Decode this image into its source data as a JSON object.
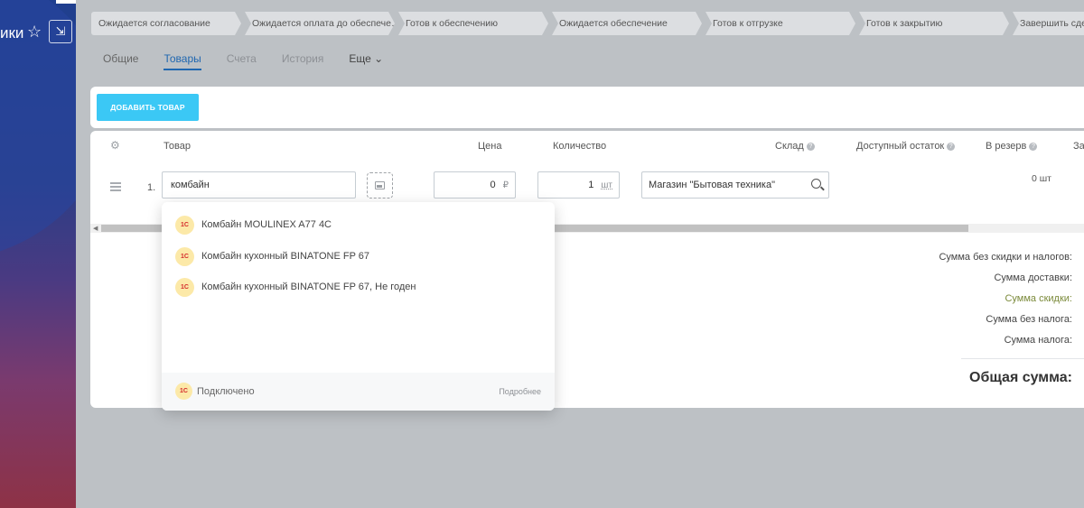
{
  "sidebar": {
    "title_fragment": "ики",
    "star_icon": "star-icon",
    "pin_icon": "collapse-arrow-icon"
  },
  "stages": [
    "Ожидается согласование",
    "Ожидается оплата до обеспече…",
    "Готов к обеспечению",
    "Ожидается обеспечение",
    "Готов к отгрузке",
    "Готов к закрытию",
    "Завершить сдел"
  ],
  "tabs": [
    {
      "label": "Общие",
      "state": "normal"
    },
    {
      "label": "Товары",
      "state": "active"
    },
    {
      "label": "Счета",
      "state": "muted"
    },
    {
      "label": "История",
      "state": "muted"
    },
    {
      "label": "Еще ⌄",
      "state": "more"
    }
  ],
  "toolbar": {
    "add_button": "ДОБАВИТЬ ТОВАР"
  },
  "table": {
    "headers": {
      "product": "Товар",
      "price": "Цена",
      "quantity": "Количество",
      "warehouse": "Склад",
      "available": "Доступный остаток",
      "reserve": "В резерв",
      "cut": "За"
    },
    "row": {
      "num": "1.",
      "product_value": "комбайн",
      "price_value": "0",
      "currency": "₽",
      "qty_value": "1",
      "qty_unit": "шт",
      "warehouse_value": "Магазин \"Бытовая техника\"",
      "available": "0 шт"
    }
  },
  "totals": {
    "no_discount_tax": "Сумма без скидки и налогов:",
    "delivery": "Сумма доставки:",
    "discount": "Сумма скидки:",
    "no_tax": "Сумма без налога:",
    "tax": "Сумма налога:",
    "grand": "Общая сумма:"
  },
  "dropdown": {
    "logo_text": "1С",
    "items": [
      "Комбайн MOULINEX A77 4C",
      "Комбайн кухонный BINATONE FP 67",
      "Комбайн кухонный BINATONE FP 67, Не годен"
    ],
    "footer_status": "Подключено",
    "footer_more": "Подробнее"
  },
  "colors": {
    "accent": "#3bc8f5",
    "link": "#2067b0",
    "discount": "#7b8a3a"
  }
}
